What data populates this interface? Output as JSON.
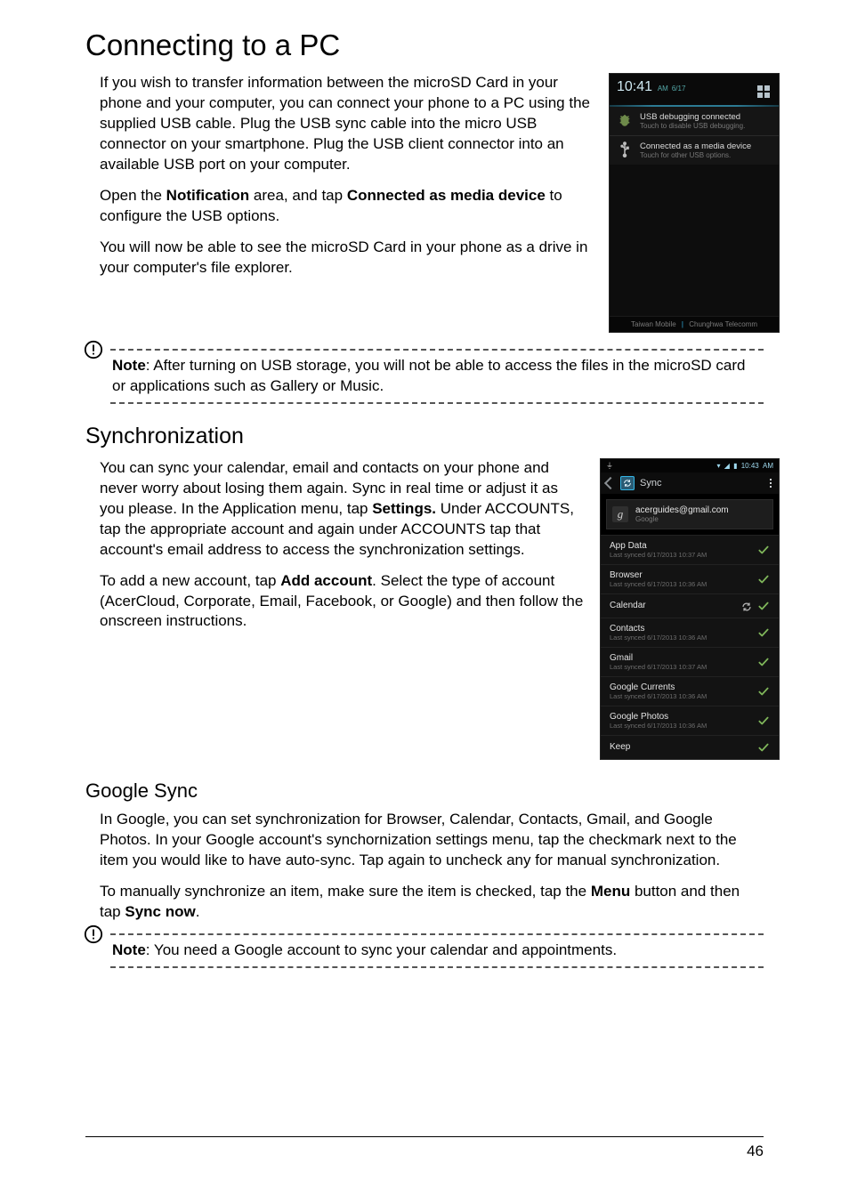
{
  "page": {
    "number": "46"
  },
  "h1": "Connecting to a PC",
  "p_pc_1": "If you wish to transfer information between the microSD Card in your phone and your computer, you can connect your phone to a PC using the supplied USB cable. Plug the USB sync cable into the micro USB connector on your smartphone. Plug the USB client connector into an available USB port on your computer.",
  "p_pc_2a": "Open the ",
  "p_pc_2b": "Notification",
  "p_pc_2c": " area, and tap ",
  "p_pc_2d": "Connected as media device",
  "p_pc_2e": " to configure the USB options.",
  "p_pc_3": "You will now be able to see the microSD Card in your phone as a drive in your computer's file explorer.",
  "note1_label": "Note",
  "note1_text": ": After turning on USB storage, you will not be able to access the files in the microSD card or applications such as Gallery or Music.",
  "h2_sync": "Synchronization",
  "p_sync_1a": "You can sync your calendar, email and contacts on your phone and never worry about losing them again. Sync in real time or adjust it as you please. In the Application menu, tap ",
  "p_sync_1b": "Settings.",
  "p_sync_1c": " Under ACCOUNTS, tap the appropriate account and again under ACCOUNTS tap that account's email address to access the synchronization settings.",
  "p_sync_2a": "To add a new account, tap ",
  "p_sync_2b": "Add account",
  "p_sync_2c": ". Select the type of account (AcerCloud, Corporate, Email, Facebook, or Google) and then follow the onscreen instructions.",
  "h3_gsync": "Google Sync",
  "p_gsync_1": "In Google, you can set synchronization for Browser, Calendar, Contacts, Gmail, and Google Photos. In your Google account's synchornization settings menu, tap the checkmark next to the item you would like to have auto-sync. Tap again to uncheck any for manual synchronization.",
  "p_gsync_2a": "To manually synchronize an item, make sure the item is checked, tap the ",
  "p_gsync_2b": "Menu",
  "p_gsync_2c": " button and then tap ",
  "p_gsync_2d": "Sync now",
  "p_gsync_2e": ".",
  "note2_label": "Note",
  "note2_text": ": You need a Google account to sync your calendar and appointments.",
  "notif": {
    "time": "10:41",
    "time_suffix": " AM",
    "date_small": "6/17",
    "rows": [
      {
        "title": "USB debugging connected",
        "sub": "Touch to disable USB debugging."
      },
      {
        "title": "Connected as a media device",
        "sub": "Touch for other USB options."
      }
    ],
    "foot_left": "Taiwan Mobile",
    "foot_right": "Chunghwa Telecomm"
  },
  "sync": {
    "status_time": "10:43",
    "status_suffix": "AM",
    "header_title": "Sync",
    "account_email": "acerguides@gmail.com",
    "account_provider": "Google",
    "account_glyph": "g",
    "items": [
      {
        "title": "App Data",
        "sub": "Last synced 6/17/2013 10:37 AM",
        "spin": false
      },
      {
        "title": "Browser",
        "sub": "Last synced 6/17/2013 10:36 AM",
        "spin": false
      },
      {
        "title": "Calendar",
        "sub": "",
        "spin": true
      },
      {
        "title": "Contacts",
        "sub": "Last synced 6/17/2013 10:36 AM",
        "spin": false
      },
      {
        "title": "Gmail",
        "sub": "Last synced 6/17/2013 10:37 AM",
        "spin": false
      },
      {
        "title": "Google Currents",
        "sub": "Last synced 6/17/2013 10:36 AM",
        "spin": false
      },
      {
        "title": "Google Photos",
        "sub": "Last synced 6/17/2013 10:36 AM",
        "spin": false
      },
      {
        "title": "Keep",
        "sub": "",
        "spin": false
      }
    ]
  }
}
